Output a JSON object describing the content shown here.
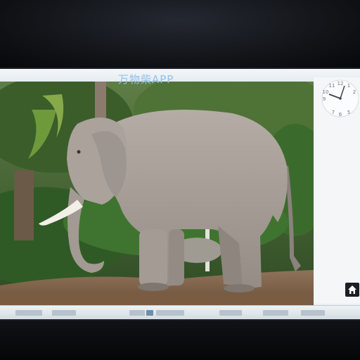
{
  "app": {
    "title": "万物柴APP"
  },
  "clock": {
    "numerals": [
      "12",
      "1",
      "2",
      "11",
      "10",
      "9",
      "7",
      "6",
      "5"
    ]
  },
  "icons": {
    "home": "home-icon",
    "clock": "analog-clock-icon"
  },
  "colors": {
    "title": "#8fc3ec",
    "screen_bg": "#e9eef2",
    "foliage": "#3e6b2e",
    "ground": "#8a6a4e",
    "elephant": "#a59e98"
  }
}
